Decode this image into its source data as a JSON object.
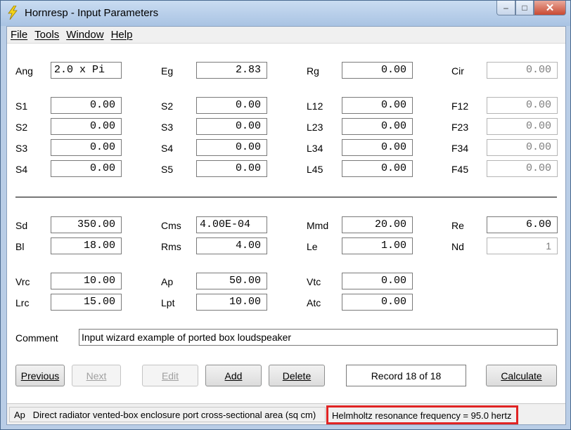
{
  "window": {
    "title": "Hornresp - Input Parameters",
    "minimize": "‒",
    "maximize": "□",
    "close": "✕"
  },
  "menu": [
    "File",
    "Tools",
    "Window",
    "Help"
  ],
  "params": {
    "Ang": "2.0 x Pi",
    "Eg": "2.83",
    "Rg": "0.00",
    "Cir": "0.00",
    "S1a": "0.00",
    "S2a": "0.00",
    "L12": "0.00",
    "F12": "0.00",
    "S2b": "0.00",
    "S3a": "0.00",
    "L23": "0.00",
    "F23": "0.00",
    "S3b": "0.00",
    "S4a": "0.00",
    "L34": "0.00",
    "F34": "0.00",
    "S4b": "0.00",
    "S5": "0.00",
    "L45": "0.00",
    "F45": "0.00",
    "Sd": "350.00",
    "Cms": "4.00E-04",
    "Mmd": "20.00",
    "Re": "6.00",
    "Bl": "18.00",
    "Rms": "4.00",
    "Le": "1.00",
    "Nd": "1",
    "Vrc": "10.00",
    "Ap": "50.00",
    "Vtc": "0.00",
    "Lrc": "15.00",
    "Lpt": "10.00",
    "Atc": "0.00"
  },
  "labels": {
    "Ang": "Ang",
    "Eg": "Eg",
    "Rg": "Rg",
    "Cir": "Cir",
    "S1": "S1",
    "S2": "S2",
    "S3": "S3",
    "S4": "S4",
    "S5": "S5",
    "L12": "L12",
    "L23": "L23",
    "L34": "L34",
    "L45": "L45",
    "F12": "F12",
    "F23": "F23",
    "F34": "F34",
    "F45": "F45",
    "Sd": "Sd",
    "Cms": "Cms",
    "Mmd": "Mmd",
    "Re": "Re",
    "Bl": "Bl",
    "Rms": "Rms",
    "Le": "Le",
    "Nd": "Nd",
    "Vrc": "Vrc",
    "Ap": "Ap",
    "Vtc": "Vtc",
    "Lrc": "Lrc",
    "Lpt": "Lpt",
    "Atc": "Atc",
    "Comment": "Comment"
  },
  "comment": "Input wizard example of ported box loudspeaker",
  "buttons": {
    "previous": "Previous",
    "next": "Next",
    "edit": "Edit",
    "add": "Add",
    "delete": "Delete",
    "calculate": "Calculate"
  },
  "record": "Record 18 of 18",
  "status": {
    "param": "Ap",
    "description": "Direct radiator vented-box enclosure port cross-sectional area  (sq cm)",
    "helmholtz": "Helmholtz resonance frequency = 95.0 hertz"
  }
}
